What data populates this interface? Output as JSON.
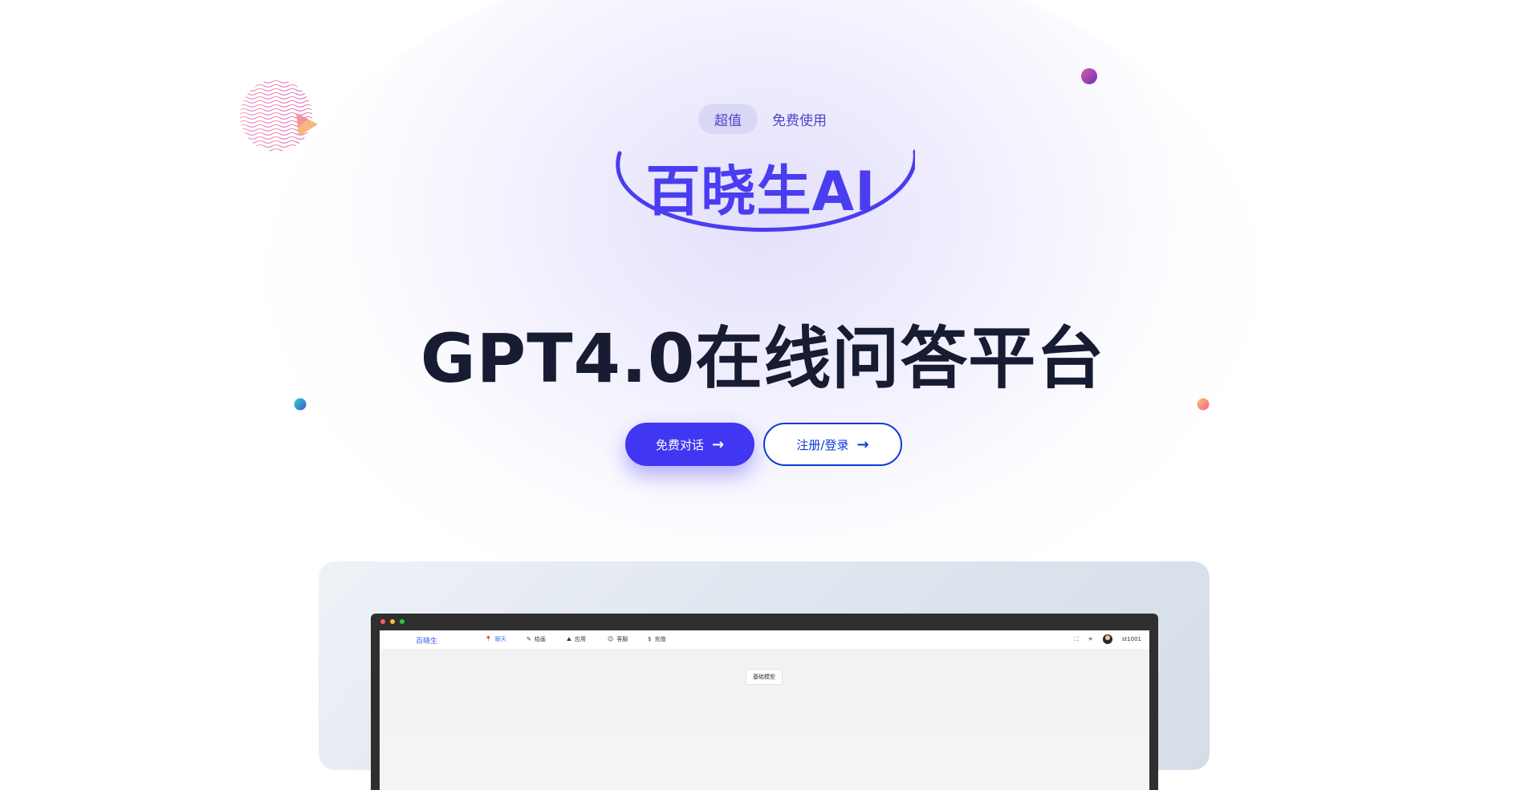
{
  "hero": {
    "badge": "超值",
    "badge_text": "免费使用",
    "brand": "百晓生AI",
    "headline": "GPT4.0在线问答平台"
  },
  "buttons": {
    "primary_label": "免费对话",
    "secondary_label": "注册/登录",
    "arrow_icon": "→"
  },
  "preview": {
    "app_logo": "百晓生",
    "nav": [
      {
        "label": "聊天",
        "icon": "pin-icon",
        "glyph": "📍"
      },
      {
        "label": "绘画",
        "icon": "pencil-icon",
        "glyph": "✎"
      },
      {
        "label": "应用",
        "icon": "apps-icon",
        "glyph": "⛰"
      },
      {
        "label": "客服",
        "icon": "support-icon",
        "glyph": "☺"
      },
      {
        "label": "充值",
        "icon": "dollar-icon",
        "glyph": "$"
      }
    ],
    "fullscreen_glyph": "⛶",
    "theme_glyph": "☀",
    "username": "st1001",
    "model_chip": "基础模型"
  },
  "colors": {
    "accent": "#4136f1",
    "brand": "#4a3df0",
    "headline": "#171c33",
    "link": "#0e3bd6"
  }
}
